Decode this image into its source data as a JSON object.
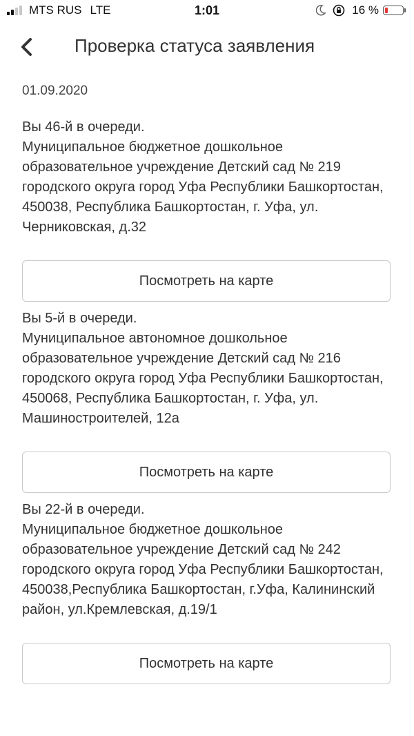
{
  "status_bar": {
    "carrier": "MTS RUS",
    "network": "LTE",
    "time": "1:01",
    "battery_percent": "16 %",
    "battery_level": 0.16,
    "battery_color": "#e53935",
    "icons": [
      "signal-icon",
      "moon-icon",
      "orientation-lock-icon",
      "battery-icon"
    ]
  },
  "header": {
    "back_icon": "chevron-left-icon",
    "title": "Проверка статуса заявления"
  },
  "date": "01.09.2020",
  "entries": [
    {
      "queue": "Вы 46-й в очереди.",
      "organization": "Муниципальное бюджетное дошкольное образовательное учреждение Детский сад № 219 городского округа город Уфа Республики Башкортостан, 450038, Республика Башкортостан, г. Уфа, ул. Черниковская, д.32",
      "button": "Посмотреть на карте"
    },
    {
      "queue": "Вы 5-й в очереди.",
      "organization": "Муниципальное автономное дошкольное образовательное учреждение Детский сад № 216 городского округа город Уфа Республики Башкортостан, 450068, Республика Башкортостан, г. Уфа, ул. Машиностроителей, 12а",
      "button": "Посмотреть на карте"
    },
    {
      "queue": "Вы 22-й в очереди.",
      "organization": "Муниципальное бюджетное дошкольное образовательное учреждение Детский сад № 242 городского округа город Уфа Республики Башкортостан, 450038,Республика Башкортостан, г.Уфа, Калининский район, ул.Кремлевская, д.19/1",
      "button": "Посмотреть на карте"
    }
  ]
}
